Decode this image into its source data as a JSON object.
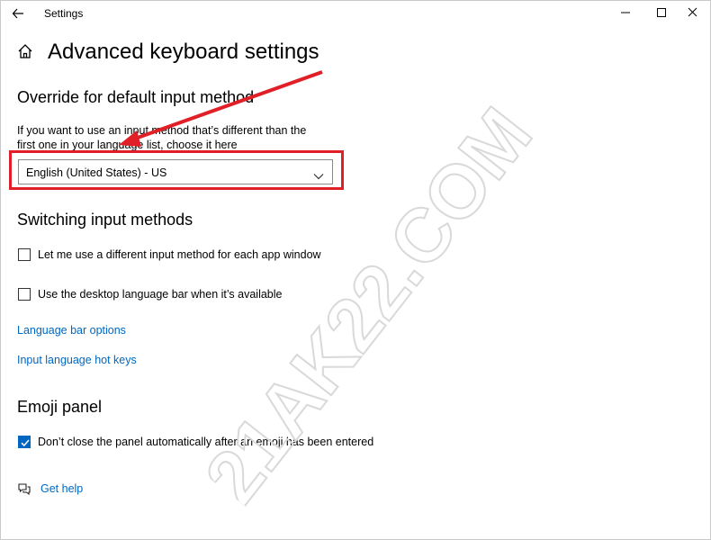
{
  "window": {
    "title": "Settings",
    "back_icon": "back-arrow-icon",
    "controls": [
      "minimize",
      "maximize",
      "close"
    ]
  },
  "header": {
    "home_icon": "home-icon",
    "title": "Advanced keyboard settings"
  },
  "override": {
    "heading": "Override for default input method",
    "description_line1": "If you want to use an input method that’s different than the",
    "description_line2": "first one in your language list, choose it here",
    "selected": "English (United States) - US"
  },
  "switching": {
    "heading": "Switching input methods",
    "options": [
      {
        "label": "Let me use a different input method for each app window",
        "checked": false
      },
      {
        "label": "Use the desktop language bar when it’s available",
        "checked": false
      }
    ],
    "links": [
      "Language bar options",
      "Input language hot keys"
    ]
  },
  "emoji": {
    "heading": "Emoji panel",
    "option": {
      "label": "Don’t close the panel automatically after an emoji has been entered",
      "checked": true
    }
  },
  "help": {
    "label": "Get help",
    "icon": "chat-help-icon"
  },
  "annotation": {
    "highlight_color": "#e01f26",
    "arrow_color": "#e01f26"
  },
  "watermark": {
    "text": "21AK22.COM"
  },
  "colors": {
    "accent": "#0067c0"
  }
}
